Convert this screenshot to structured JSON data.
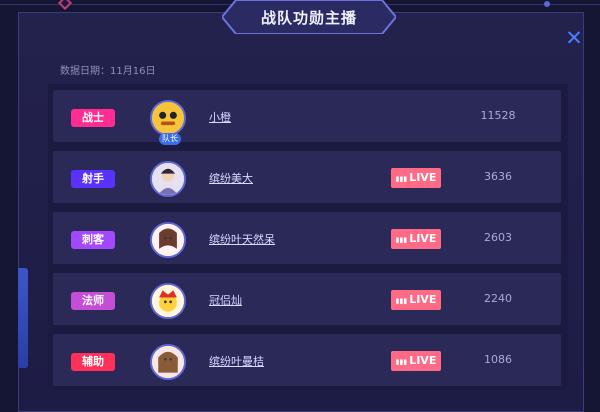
{
  "header": {
    "title": "战队功勋主播",
    "close_icon": "close-icon"
  },
  "date_label": "数据日期：11月16日",
  "rows": [
    {
      "role": "战士",
      "role_color": "#ff2d91",
      "name": "小橙",
      "captain": true,
      "captain_label": "队长",
      "live": false,
      "score": "11528"
    },
    {
      "role": "射手",
      "role_color": "#5a32ff",
      "name": "缤纷美大",
      "captain": false,
      "live": true,
      "live_label": "LIVE",
      "score": "3636"
    },
    {
      "role": "刺客",
      "role_color": "#a249ff",
      "name": "缤纷叶天然呆",
      "captain": false,
      "live": true,
      "live_label": "LIVE",
      "score": "2603"
    },
    {
      "role": "法师",
      "role_color": "#c44fd6",
      "name": "冠侣灿",
      "captain": false,
      "live": true,
      "live_label": "LIVE",
      "score": "2240"
    },
    {
      "role": "辅助",
      "role_color": "#ff3158",
      "name": "缤纷叶曼桔",
      "captain": false,
      "live": true,
      "live_label": "LIVE",
      "score": "1086"
    }
  ]
}
